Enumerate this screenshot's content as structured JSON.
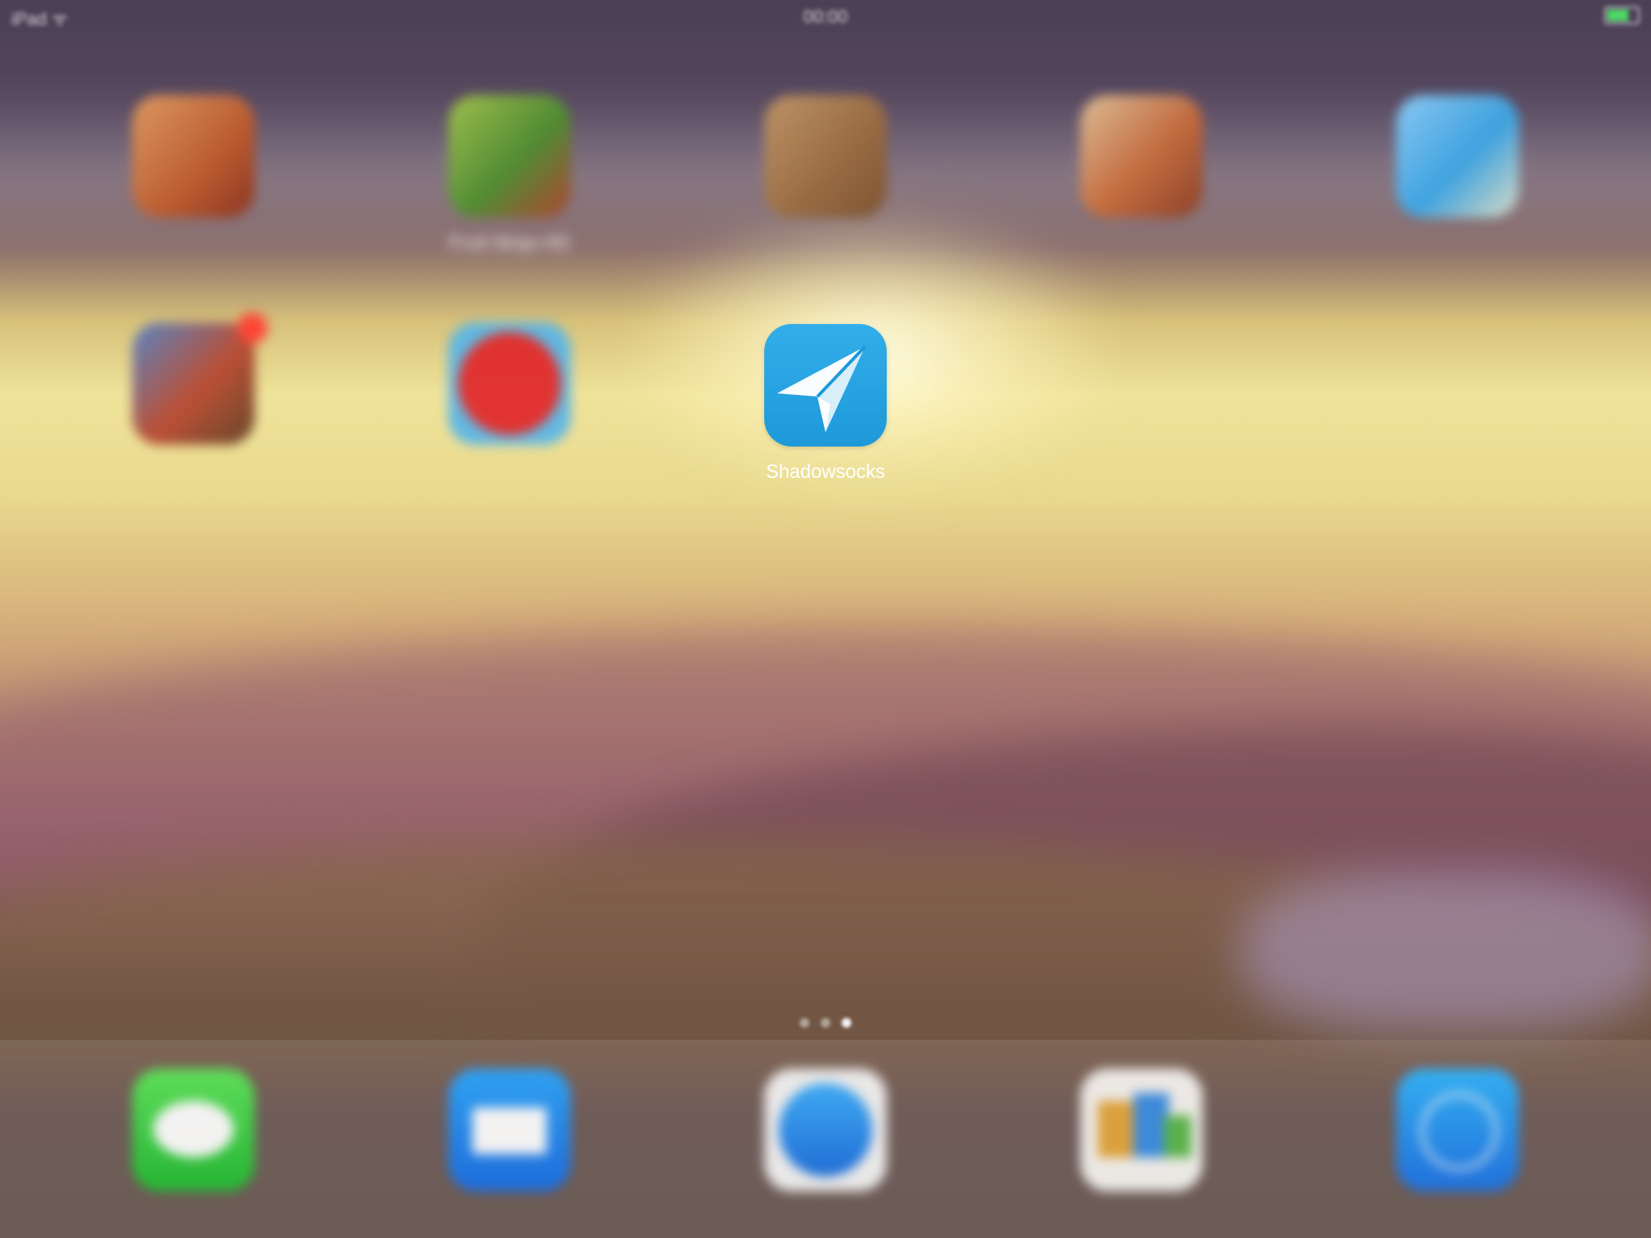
{
  "status_bar": {
    "carrier": "iPad ᯤ",
    "time": "00:00",
    "battery": "",
    "battery_level": 0.75
  },
  "home_screen": {
    "apps_row1": [
      {
        "label": "",
        "icon": "pagoda-game-icon"
      },
      {
        "label": "Fruit Ninja HD",
        "icon": "fruit-ninja-icon"
      },
      {
        "label": "",
        "icon": "wooden-board-game-icon"
      },
      {
        "label": "",
        "icon": "card-game-icon"
      },
      {
        "label": "",
        "icon": "sky-cartoon-icon"
      }
    ],
    "apps_row2": [
      {
        "label": "",
        "icon": "warrior-game-icon",
        "badge": true
      },
      {
        "label": "",
        "icon": "red-button-icon"
      },
      {
        "label": "Shadowsocks",
        "icon": "paper-plane-icon"
      }
    ],
    "page_dots": 3,
    "active_page": 3
  },
  "dock": {
    "apps": [
      {
        "label": "",
        "icon": "messages-icon"
      },
      {
        "label": "",
        "icon": "mail-icon"
      },
      {
        "label": "",
        "icon": "safari-icon"
      },
      {
        "label": "",
        "icon": "photos-grid-icon"
      },
      {
        "label": "",
        "icon": "app-store-icon"
      }
    ]
  }
}
